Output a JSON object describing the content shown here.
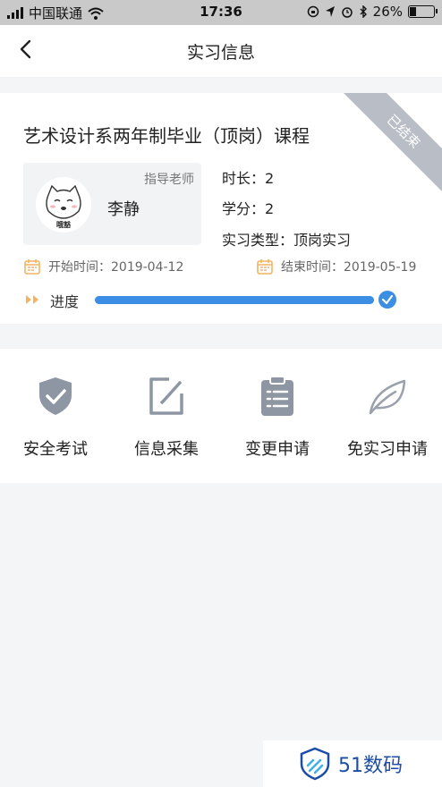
{
  "status_bar": {
    "carrier": "中国联通",
    "time": "17:36",
    "battery": "26%",
    "battery_level": 0.26
  },
  "nav": {
    "title": "实习信息"
  },
  "course": {
    "title": "艺术设计系两年制毕业（顶岗）课程",
    "badge": "已结束",
    "teacher": {
      "label": "指导老师",
      "name": "李静",
      "avatar_caption": "哦豁"
    },
    "duration": "时长：2",
    "credit": "学分：2",
    "type": "实习类型：顶岗实习",
    "start": "开始时间：2019-04-12",
    "end": "结束时间：2019-05-19",
    "progress_label": "进度",
    "progress": 1.0
  },
  "actions": [
    {
      "label": "安全考试",
      "icon": "shield-check-icon"
    },
    {
      "label": "信息采集",
      "icon": "edit-icon"
    },
    {
      "label": "变更申请",
      "icon": "clipboard-icon"
    },
    {
      "label": "免实习申请",
      "icon": "leaf-icon"
    }
  ],
  "watermark": {
    "text": "51数码"
  },
  "colors": {
    "accent": "#3b8ee4",
    "icon_gray": "#8e96a3",
    "date_icon": "#f3b462",
    "badge_bg": "#b9bec6",
    "watermark": "#1d4da6"
  }
}
